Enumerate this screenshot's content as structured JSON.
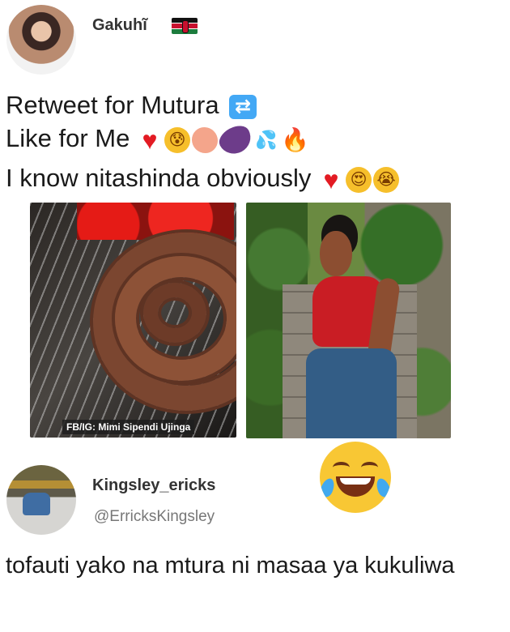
{
  "post": {
    "author": "Gakuhĩ",
    "flag_icon": "kenya-flag-icon",
    "lines": [
      "Retweet for Mutura",
      "Like for Me",
      "I know nitashinda obviously"
    ],
    "retweet_icon": "retweet-icon",
    "like_emojis": [
      "red-heart-icon",
      "fearful-face-icon",
      "peach-icon",
      "eggplant-icon",
      "sweat-droplets-icon",
      "fire-icon"
    ],
    "third_line_emojis": [
      "red-heart-icon",
      "heart-eyes-face-icon",
      "crying-face-icon"
    ]
  },
  "images": {
    "left_watermark": "FB/IG: Mimi Sipendi Ujinga",
    "left_subject": "mutura-sausage-photo",
    "right_subject": "woman-photo"
  },
  "reaction_icon": "laughing-with-tears-icon",
  "reply": {
    "author": "Kingsley_ericks",
    "handle": "@ErricksKingsley",
    "text": "tofauti yako na mtura ni masaa ya kukuliwa"
  },
  "colors": {
    "heart": "#e31b23",
    "retweet": "#43a8f5",
    "emoji_yellow": "#f8c734"
  }
}
